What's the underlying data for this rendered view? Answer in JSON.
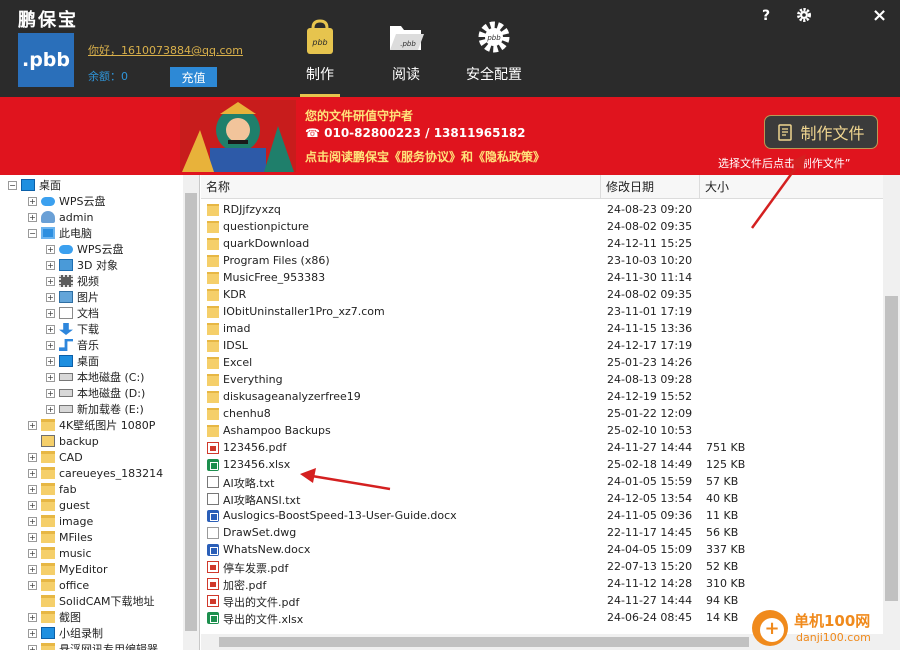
{
  "header": {
    "app_title": "鹏保宝",
    "logo_text": ".pbb",
    "greeting": "你好，1610073884@qq.com",
    "balance": "余额：0",
    "recharge_label": "充值",
    "tabs": [
      {
        "label": "制作",
        "icon": "pbb-bag-icon",
        "active": true
      },
      {
        "label": "阅读",
        "icon": "pbb-folder-icon",
        "active": false
      },
      {
        "label": "安全配置",
        "icon": "pbb-gear-icon",
        "active": false
      }
    ],
    "help_label": "?",
    "settings_icon": "gear-icon",
    "close_label": "×",
    "accent_color": "#e6c44e"
  },
  "banner": {
    "line1": "您的文件研值守护者",
    "line2": "010-82800223 / 13811965182",
    "line3": "点击阅读鹏保宝《服务协议》和《隐私政策》",
    "make_file_label": "制作文件",
    "hint": "选择文件后点击“制作文件”",
    "bg_color": "#e0141e"
  },
  "tree": {
    "items": [
      {
        "label": "桌面",
        "icon": "desktop-icon",
        "expander": "−"
      },
      {
        "label": "WPS云盘",
        "icon": "cloud-icon",
        "expander": "+"
      },
      {
        "label": "admin",
        "icon": "user-icon",
        "expander": "+"
      },
      {
        "label": "此电脑",
        "icon": "pc-icon",
        "expander": "−"
      },
      {
        "label": "WPS云盘",
        "icon": "cloud-icon",
        "expander": "+"
      },
      {
        "label": "3D 对象",
        "icon": "3d-objects-icon",
        "expander": "+"
      },
      {
        "label": "视频",
        "icon": "video-icon",
        "expander": "+"
      },
      {
        "label": "图片",
        "icon": "picture-icon",
        "expander": "+"
      },
      {
        "label": "文档",
        "icon": "document-icon",
        "expander": "+"
      },
      {
        "label": "下载",
        "icon": "download-icon",
        "expander": "+"
      },
      {
        "label": "音乐",
        "icon": "music-icon",
        "expander": "+"
      },
      {
        "label": "桌面",
        "icon": "desktop-icon",
        "expander": "+"
      },
      {
        "label": "本地磁盘 (C:)",
        "icon": "drive-icon",
        "expander": "+"
      },
      {
        "label": "本地磁盘 (D:)",
        "icon": "drive-icon",
        "expander": "+"
      },
      {
        "label": "新加载卷 (E:)",
        "icon": "drive-icon",
        "expander": "+"
      },
      {
        "label": "4K壁纸图片 1080P",
        "icon": "folder-icon",
        "expander": "+"
      },
      {
        "label": "backup",
        "icon": "backup-folder-icon",
        "expander": ""
      },
      {
        "label": "CAD",
        "icon": "folder-icon",
        "expander": "+"
      },
      {
        "label": "careueyes_183214",
        "icon": "folder-icon",
        "expander": "+"
      },
      {
        "label": "fab",
        "icon": "folder-icon",
        "expander": "+"
      },
      {
        "label": "guest",
        "icon": "folder-icon",
        "expander": "+"
      },
      {
        "label": "image",
        "icon": "folder-icon",
        "expander": "+"
      },
      {
        "label": "MFiles",
        "icon": "folder-icon",
        "expander": "+"
      },
      {
        "label": "music",
        "icon": "folder-icon",
        "expander": "+"
      },
      {
        "label": "MyEditor",
        "icon": "folder-icon",
        "expander": "+"
      },
      {
        "label": "office",
        "icon": "folder-icon",
        "expander": "+"
      },
      {
        "label": "SolidCAM下载地址",
        "icon": "folder-icon",
        "expander": ""
      },
      {
        "label": "截图",
        "icon": "folder-icon",
        "expander": "+"
      },
      {
        "label": "小组录制",
        "icon": "desktop-icon",
        "expander": "+"
      },
      {
        "label": "悬浮网讯专用编辑器",
        "icon": "folder-icon",
        "expander": "+"
      }
    ]
  },
  "filelist": {
    "columns": {
      "name": "名称",
      "modified": "修改日期",
      "size": "大小"
    },
    "rows": [
      {
        "name": "RDJjfzyxzq",
        "date": "24-08-23 09:20",
        "size": "",
        "type": "folder"
      },
      {
        "name": "questionpicture",
        "date": "24-08-02 09:35",
        "size": "",
        "type": "folder"
      },
      {
        "name": "quarkDownload",
        "date": "24-12-11 15:25",
        "size": "",
        "type": "folder"
      },
      {
        "name": "Program Files (x86)",
        "date": "23-10-03 10:20",
        "size": "",
        "type": "folder"
      },
      {
        "name": "MusicFree_953383",
        "date": "24-11-30 11:14",
        "size": "",
        "type": "folder"
      },
      {
        "name": "KDR",
        "date": "24-08-02 09:35",
        "size": "",
        "type": "folder"
      },
      {
        "name": "IObitUninstaller1Pro_xz7.com",
        "date": "23-11-01 17:19",
        "size": "",
        "type": "folder"
      },
      {
        "name": "imad",
        "date": "24-11-15 13:36",
        "size": "",
        "type": "folder"
      },
      {
        "name": "IDSL",
        "date": "24-12-17 17:19",
        "size": "",
        "type": "folder"
      },
      {
        "name": "Excel",
        "date": "25-01-23 14:26",
        "size": "",
        "type": "folder"
      },
      {
        "name": "Everything",
        "date": "24-08-13 09:28",
        "size": "",
        "type": "folder"
      },
      {
        "name": "diskusageanalyzerfree19",
        "date": "24-12-19 15:52",
        "size": "",
        "type": "folder"
      },
      {
        "name": "chenhu8",
        "date": "25-01-22 12:09",
        "size": "",
        "type": "folder"
      },
      {
        "name": "Ashampoo Backups",
        "date": "25-02-10 10:53",
        "size": "",
        "type": "folder"
      },
      {
        "name": "123456.pdf",
        "date": "24-11-27 14:44",
        "size": "751 KB",
        "type": "pdf"
      },
      {
        "name": "123456.xlsx",
        "date": "25-02-18 14:49",
        "size": "125 KB",
        "type": "xlsx"
      },
      {
        "name": "AI攻略.txt",
        "date": "24-01-05 15:59",
        "size": "57 KB",
        "type": "txt"
      },
      {
        "name": "AI攻略ANSI.txt",
        "date": "24-12-05 13:54",
        "size": "40 KB",
        "type": "txt"
      },
      {
        "name": "Auslogics-BoostSpeed-13-User-Guide.docx",
        "date": "24-11-05 09:36",
        "size": "11 KB",
        "type": "docx"
      },
      {
        "name": "DrawSet.dwg",
        "date": "22-11-17 14:45",
        "size": "56 KB",
        "type": "dwg"
      },
      {
        "name": "WhatsNew.docx",
        "date": "24-04-05 15:09",
        "size": "337 KB",
        "type": "docx"
      },
      {
        "name": "停车发票.pdf",
        "date": "22-07-13 15:20",
        "size": "52 KB",
        "type": "pdf"
      },
      {
        "name": "加密.pdf",
        "date": "24-11-12 14:28",
        "size": "310 KB",
        "type": "pdf"
      },
      {
        "name": "导出的文件.pdf",
        "date": "24-11-27 14:44",
        "size": "94 KB",
        "type": "pdf"
      },
      {
        "name": "导出的文件.xlsx",
        "date": "24-06-24 08:45",
        "size": "14 KB",
        "type": "xlsx"
      }
    ]
  },
  "watermark": {
    "title": "单机100网",
    "url": "danji100.com",
    "plus": "+"
  }
}
